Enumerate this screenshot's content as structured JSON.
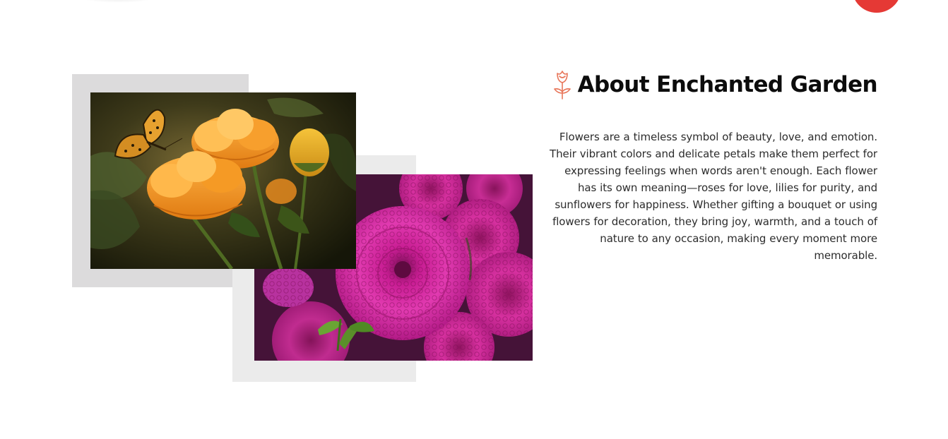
{
  "header": {
    "logo_icon": "blurred-logo",
    "menu_button_icon": "circle-menu-button",
    "accent_color": "#e53935"
  },
  "collage": {
    "photo_top_icon": "yellow-globeflowers-with-butterfly-photo",
    "photo_bottom_icon": "pink-dahlias-photo",
    "frame_color_1": "#dcdbdc",
    "frame_color_2": "#ebebeb"
  },
  "about": {
    "icon": "rose-icon",
    "icon_color": "#e8765a",
    "title": "About Enchanted Garden",
    "paragraph": "Flowers are a timeless symbol of beauty, love, and emotion. Their vibrant colors and delicate petals make them perfect for expressing feelings when words aren't enough. Each flower has its own meaning—roses for love, lilies for purity, and sunflowers for happiness. Whether gifting a bouquet or using flowers for decoration, they bring joy, warmth, and a touch of nature to any occasion, making every moment more memorable."
  }
}
